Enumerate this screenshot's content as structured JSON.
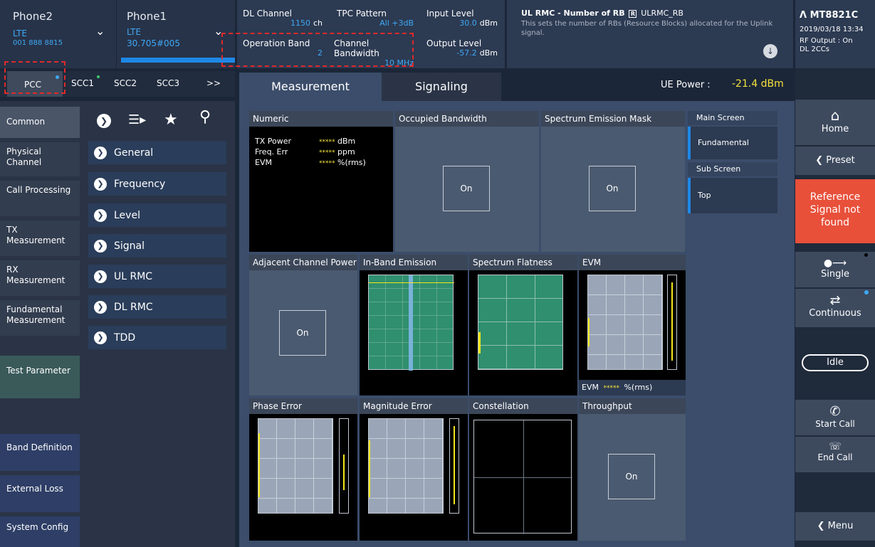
{
  "phones": [
    {
      "name": "Phone2",
      "tech": "LTE",
      "id": "001 888 8815"
    },
    {
      "name": "Phone1",
      "tech": "LTE",
      "id": "30.705#005"
    }
  ],
  "dl_channel": {
    "label": "DL Channel",
    "value": "1150",
    "unit": "ch"
  },
  "tpc_pattern": {
    "label": "TPC Pattern",
    "value": "All +3dB"
  },
  "input_level": {
    "label": "Input Level",
    "value": "30.0",
    "unit": "dBm"
  },
  "operation_band": {
    "label": "Operation Band",
    "value": "2"
  },
  "channel_bandwidth": {
    "label": "Channel Bandwidth",
    "value": "10 MHz"
  },
  "output_level": {
    "label": "Output Level",
    "value": "-57.2",
    "unit": "dBm"
  },
  "info": {
    "title": "UL RMC - Number of RB",
    "tag": "ULRMC_RB",
    "desc": "This sets the number of RBs (Resource Blocks) allocated for the Uplink signal."
  },
  "device": {
    "model": "MT8821C",
    "date": "2019/03/18 13:34",
    "rf": "RF Output : On",
    "dl": "DL 2CCs"
  },
  "carrier_tabs": [
    "PCC",
    "SCC1",
    "SCC2",
    "SCC3",
    ">>"
  ],
  "main_tabs": [
    "Measurement",
    "Signaling"
  ],
  "ue_power": {
    "label": "UE Power :",
    "value": "-21.4 dBm"
  },
  "left_menu": {
    "common": "Common",
    "items": [
      "Physical Channel",
      "Call Processing",
      "TX Measurement",
      "RX Measurement",
      "Fundamental Measurement",
      "Test Parameter",
      "Band Definition",
      "External Loss",
      "System Config"
    ]
  },
  "sub_menu": [
    "General",
    "Frequency",
    "Level",
    "Signal",
    "UL RMC",
    "DL RMC",
    "TDD"
  ],
  "panels": {
    "numeric": "Numeric",
    "occupied_bw": "Occupied Bandwidth",
    "sem": "Spectrum Emission Mask",
    "acp": "Adjacent Channel Power",
    "ibe": "In-Band Emission",
    "flatness": "Spectrum Flatness",
    "evm": "EVM",
    "phase": "Phase Error",
    "magnitude": "Magnitude Error",
    "constellation": "Constellation",
    "throughput": "Throughput",
    "on": "On"
  },
  "numeric_rows": [
    {
      "label": "TX Power",
      "value": "*****",
      "unit": "dBm"
    },
    {
      "label": "Freq. Err",
      "value": "*****",
      "unit": "ppm"
    },
    {
      "label": "EVM",
      "value": "*****",
      "unit": "%(rms)"
    }
  ],
  "evm_readout": {
    "label": "EVM",
    "value": "*****",
    "unit": "%(rms)"
  },
  "screen_select": {
    "main_label": "Main Screen",
    "main_value": "Fundamental",
    "sub_label": "Sub Screen",
    "sub_value": "Top"
  },
  "right_panel": {
    "home": "Home",
    "preset": "Preset",
    "reference": "Reference Signal not found",
    "single": "Single",
    "continuous": "Continuous",
    "idle": "Idle",
    "start_call": "Start Call",
    "end_call": "End Call",
    "menu": "Menu"
  },
  "colors": {
    "accent": "#3fa9f5",
    "alert": "#e8503a",
    "ue_power": "#f5e23a",
    "trace": "#f3e61a"
  }
}
